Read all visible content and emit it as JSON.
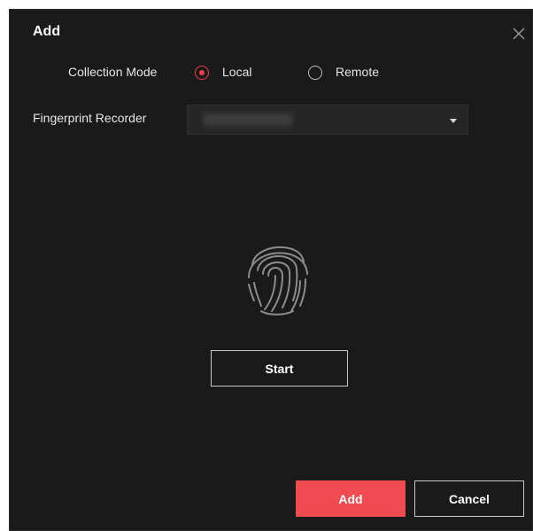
{
  "dialog": {
    "title": "Add",
    "close_icon": "close-icon"
  },
  "collection_mode": {
    "label": "Collection Mode",
    "options": [
      {
        "label": "Local",
        "selected": true
      },
      {
        "label": "Remote",
        "selected": false
      }
    ]
  },
  "fingerprint_recorder": {
    "label": "Fingerprint Recorder",
    "selected_value": ""
  },
  "fingerprint_icon": "fingerprint-icon",
  "start_button": {
    "label": "Start"
  },
  "footer": {
    "add_label": "Add",
    "cancel_label": "Cancel"
  },
  "colors": {
    "background": "#1a1a1a",
    "accent": "#ef4b51",
    "radio_selected": "#ef3e45"
  }
}
